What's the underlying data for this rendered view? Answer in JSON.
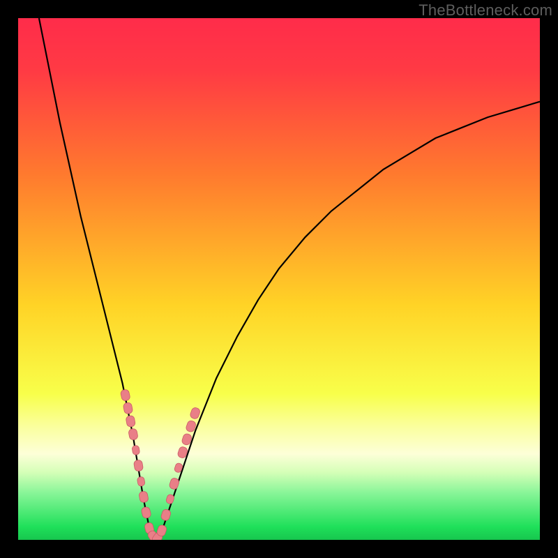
{
  "watermark": "TheBottleneck.com",
  "colors": {
    "frame": "#000000",
    "gradient_top": "#ff2c4a",
    "gradient_mid1": "#ff7a2e",
    "gradient_mid2": "#ffd326",
    "gradient_mid3": "#f8ff4a",
    "gradient_bottom": "#1fe05a",
    "curve": "#000000",
    "marker_fill": "#e97f87",
    "marker_stroke": "#c95d66"
  },
  "chart_data": {
    "type": "line",
    "title": "",
    "xlabel": "",
    "ylabel": "",
    "xlim": [
      0,
      100
    ],
    "ylim": [
      0,
      100
    ],
    "series": [
      {
        "name": "bottleneck-curve",
        "x": [
          4,
          6,
          8,
          10,
          12,
          14,
          16,
          18,
          20,
          22,
          23,
          24,
          25,
          26,
          27,
          28,
          30,
          32,
          34,
          36,
          38,
          42,
          46,
          50,
          55,
          60,
          65,
          70,
          75,
          80,
          85,
          90,
          95,
          100
        ],
        "values": [
          100,
          90,
          80,
          71,
          62,
          54,
          46,
          38,
          30,
          20,
          14,
          8,
          3,
          0,
          0,
          3,
          9,
          15,
          21,
          26,
          31,
          39,
          46,
          52,
          58,
          63,
          67,
          71,
          74,
          77,
          79,
          81,
          82.5,
          84
        ]
      }
    ],
    "markers": [
      {
        "x": 20.6,
        "y": 27.5,
        "size": 12
      },
      {
        "x": 21.1,
        "y": 25.0,
        "size": 12
      },
      {
        "x": 21.6,
        "y": 22.5,
        "size": 12
      },
      {
        "x": 22.1,
        "y": 20.0,
        "size": 12
      },
      {
        "x": 22.6,
        "y": 17.0,
        "size": 10
      },
      {
        "x": 23.1,
        "y": 14.0,
        "size": 12
      },
      {
        "x": 23.6,
        "y": 11.0,
        "size": 10
      },
      {
        "x": 24.1,
        "y": 8.0,
        "size": 12
      },
      {
        "x": 24.6,
        "y": 5.0,
        "size": 12
      },
      {
        "x": 25.2,
        "y": 2.0,
        "size": 12
      },
      {
        "x": 26.0,
        "y": 0.5,
        "size": 12
      },
      {
        "x": 26.8,
        "y": 0.5,
        "size": 12
      },
      {
        "x": 27.6,
        "y": 2.0,
        "size": 12
      },
      {
        "x": 28.4,
        "y": 5.0,
        "size": 12
      },
      {
        "x": 29.2,
        "y": 8.0,
        "size": 10
      },
      {
        "x": 30.0,
        "y": 11.0,
        "size": 12
      },
      {
        "x": 30.8,
        "y": 14.0,
        "size": 10
      },
      {
        "x": 31.6,
        "y": 17.0,
        "size": 12
      },
      {
        "x": 32.4,
        "y": 19.5,
        "size": 12
      },
      {
        "x": 33.2,
        "y": 22.0,
        "size": 12
      },
      {
        "x": 34.0,
        "y": 24.5,
        "size": 12
      }
    ],
    "gradient_stops": [
      {
        "offset": 0.0,
        "color": "#ff2c4a"
      },
      {
        "offset": 0.1,
        "color": "#ff3a44"
      },
      {
        "offset": 0.3,
        "color": "#ff7a2e"
      },
      {
        "offset": 0.55,
        "color": "#ffd326"
      },
      {
        "offset": 0.72,
        "color": "#f8ff4a"
      },
      {
        "offset": 0.78,
        "color": "#faff9a"
      },
      {
        "offset": 0.835,
        "color": "#fdffd8"
      },
      {
        "offset": 0.87,
        "color": "#d6ffb8"
      },
      {
        "offset": 0.91,
        "color": "#88f598"
      },
      {
        "offset": 0.975,
        "color": "#1fe05a"
      },
      {
        "offset": 1.0,
        "color": "#17c64e"
      }
    ]
  }
}
